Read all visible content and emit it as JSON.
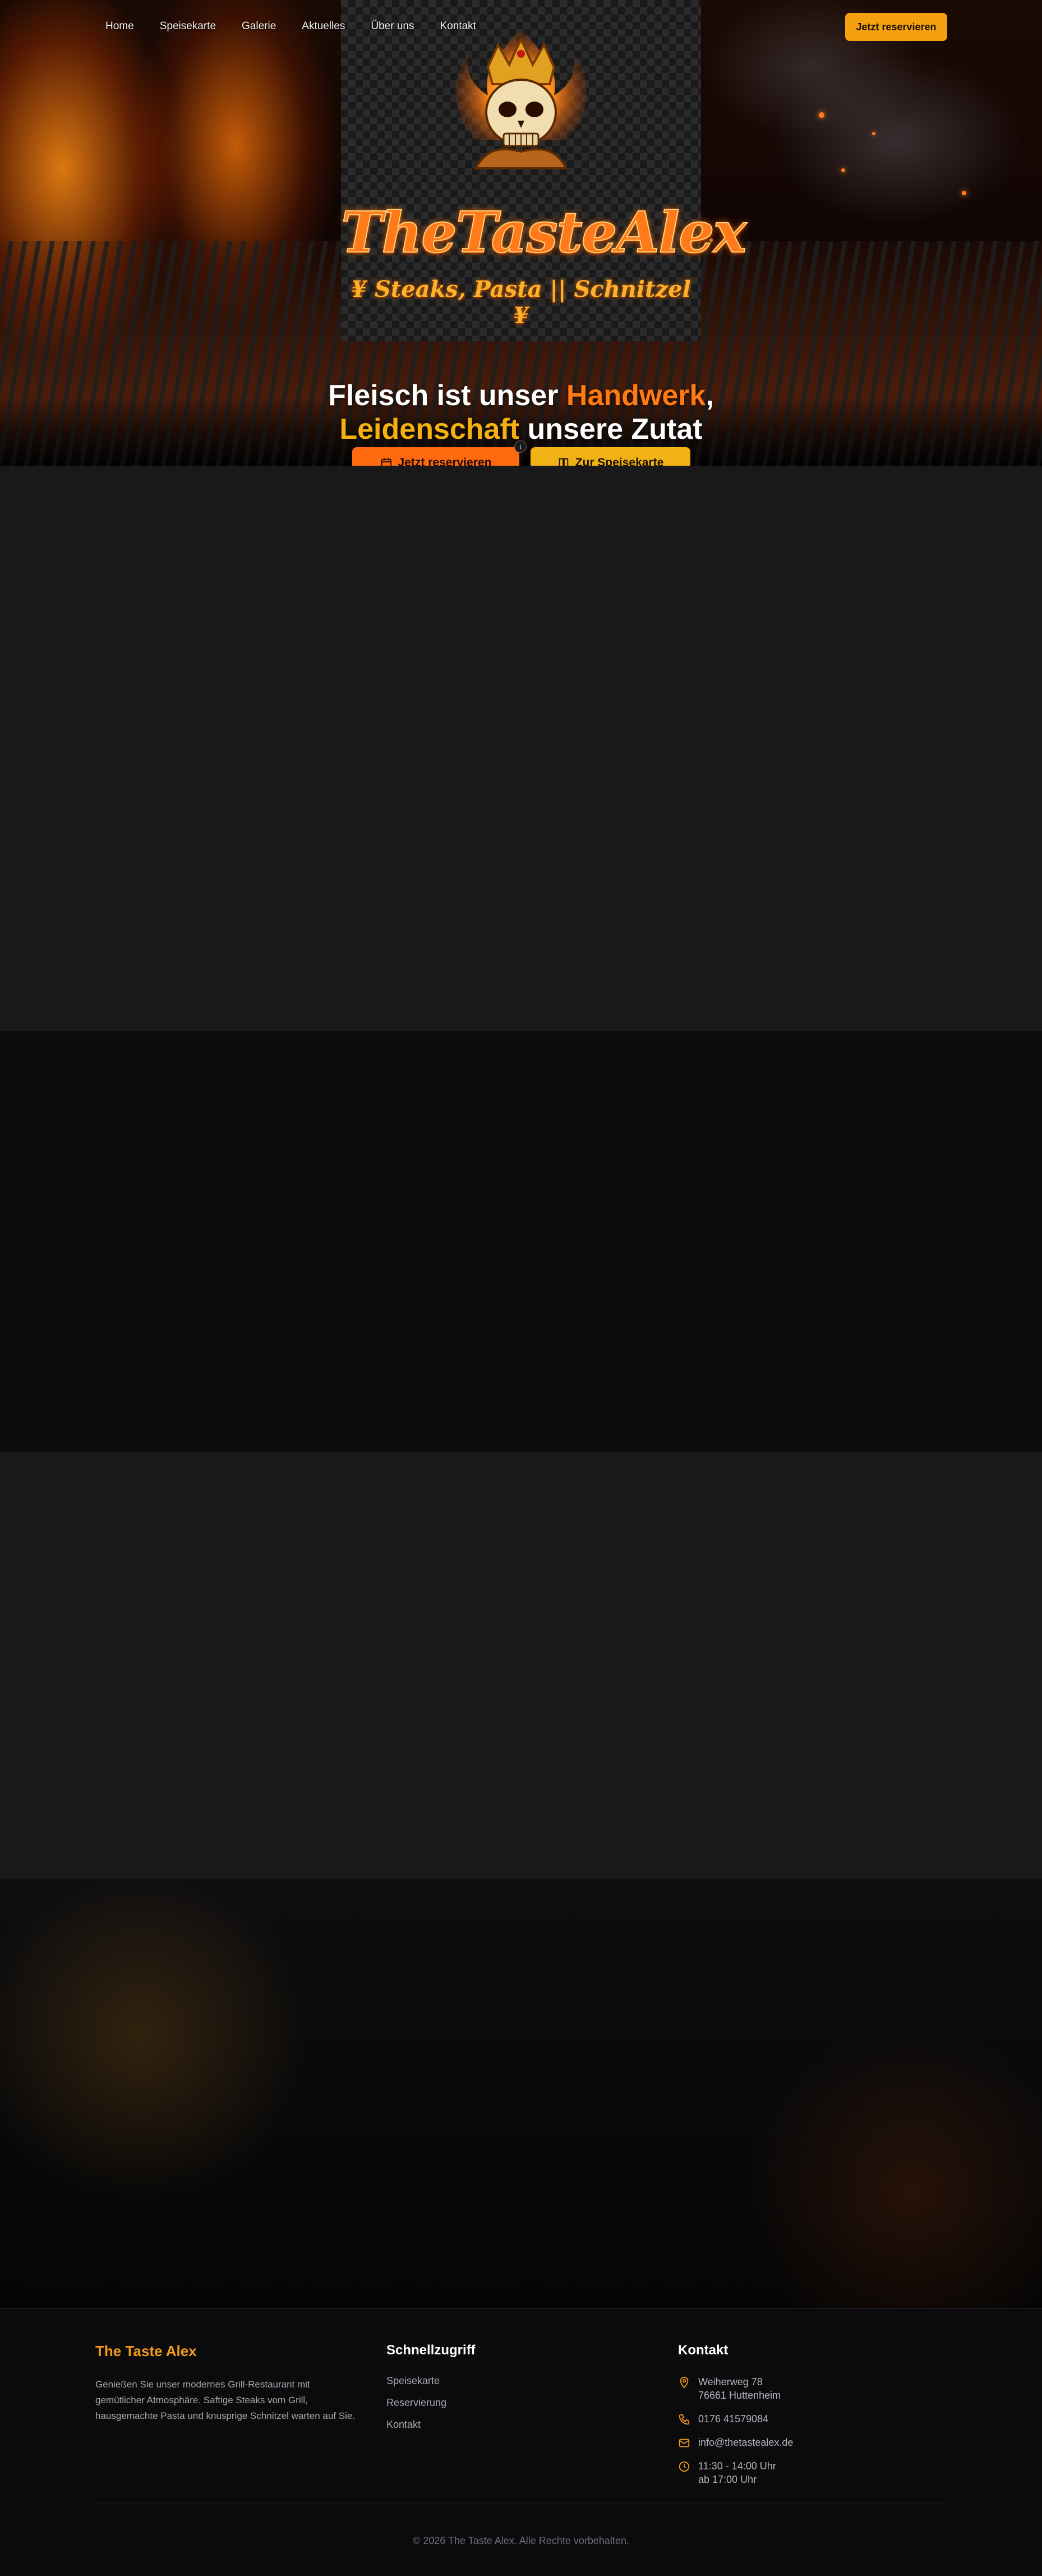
{
  "nav": {
    "items": [
      "Home",
      "Speisekarte",
      "Galerie",
      "Aktuelles",
      "Über uns",
      "Kontakt"
    ],
    "cta_label": "Jetzt reservieren"
  },
  "logo": {
    "name": "TheTasteAlex",
    "tagline": "¥ Steaks, Pasta || Schnitzel ¥"
  },
  "hero": {
    "headline_part1": "Fleisch ist unser ",
    "headline_highlight1": "Handwerk",
    "headline_part2": ",",
    "headline_highlight2": "Leidenschaft",
    "headline_part3": " unsere Zutat",
    "primary_button": "Jetzt reservieren",
    "secondary_button": "Zur Speisekarte",
    "badge": "i"
  },
  "footer": {
    "brand": "The Taste Alex",
    "description": "Genießen Sie unser modernes Grill-Restaurant mit gemütlicher Atmosphäre. Saftige Steaks vom Grill, hausgemachte Pasta und knusprige Schnitzel warten auf Sie.",
    "quick_title": "Schnellzugriff",
    "quick_links": [
      "Speisekarte",
      "Reservierung",
      "Kontakt"
    ],
    "contact_title": "Kontakt",
    "address_line1": "Weiherweg 78",
    "address_line2": "76661 Huttenheim",
    "phone": "0176 41579084",
    "email": "info@thetastealex.de",
    "hours_line1": "11:30 - 14:00 Uhr",
    "hours_line2": "ab 17:00 Uhr",
    "copyright": "© 2026 The Taste Alex. Alle Rechte vorbehalten."
  },
  "colors": {
    "accent_orange": "#ff6a10",
    "accent_gold": "#f5a10f",
    "section_dark": "#19191b",
    "section_darker": "#0b0b0d"
  },
  "icons": {
    "primary_button": "calendar-icon",
    "secondary_button": "menu-book-icon",
    "address": "map-pin-icon",
    "phone": "phone-icon",
    "email": "mail-icon",
    "hours": "clock-icon"
  }
}
